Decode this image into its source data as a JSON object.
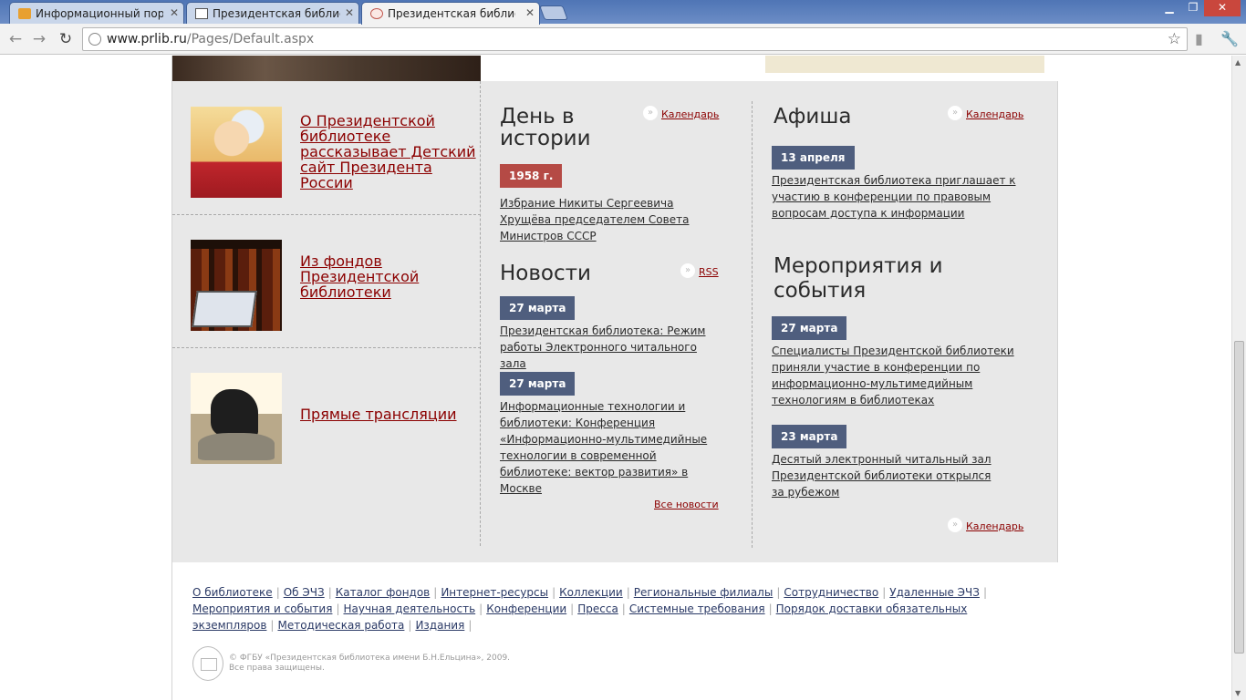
{
  "browser": {
    "tabs": [
      {
        "label": "Информационный портал",
        "active": false
      },
      {
        "label": "Президентская библиотека",
        "active": false
      },
      {
        "label": "Президентская библиотека",
        "active": true
      }
    ],
    "url_host": "www.prlib.ru",
    "url_path": "/Pages/Default.aspx"
  },
  "left": {
    "promos": [
      {
        "label": "О Президентской библиотеке рассказывает Детский сайт Президента России",
        "icon": "cartoon-boy-image"
      },
      {
        "label": "Из фондов Президентской библиотеки",
        "icon": "books-laptop-image"
      },
      {
        "label": "Прямые трансляции",
        "icon": "statue-image"
      }
    ]
  },
  "history": {
    "title": "День в истории",
    "calendar_label": "Календарь",
    "date": "1958 г.",
    "text": "Избрание Никиты Сергеевича Хрущёва председателем Совета Министров СССР"
  },
  "news": {
    "title": "Новости",
    "rss_label": "RSS",
    "items": [
      {
        "date": "27 марта",
        "text": "Президентская библиотека: Режим работы Электронного читального зала"
      },
      {
        "date": "27 марта",
        "text": "Информационные технологии и библиотеки: Конференция «Информационно-мультимедийные технологии в современной библиотеке: вектор развития» в Москве"
      }
    ],
    "all_label": "Все новости"
  },
  "afisha": {
    "title": "Афиша",
    "calendar_label": "Календарь",
    "date": "13 апреля",
    "text": "Президентская библиотека приглашает к участию в конференции по правовым вопросам доступа к информации"
  },
  "events": {
    "title": "Мероприятия и события",
    "items": [
      {
        "date": "27 марта",
        "text": "Специалисты Президентской библиотеки приняли участие в конференции по информационно-мультимедийным технологиям в библиотеках"
      },
      {
        "date": "23 марта",
        "text": "Десятый электронный читальный зал Президентской библиотеки открылся за рубежом"
      }
    ],
    "calendar_label": "Календарь"
  },
  "footer": {
    "links": [
      "О библиотеке",
      "Об ЭЧЗ",
      "Каталог фондов",
      "Интернет-ресурсы",
      "Коллекции",
      "Региональные филиалы",
      "Сотрудничество",
      "Удаленные ЭЧЗ",
      "Мероприятия и события",
      "Научная деятельность",
      "Конференции",
      "Пресса",
      "Системные требования",
      "Порядок доставки обязательных экземпляров",
      "Методическая работа",
      "Издания"
    ],
    "copyright_line1": "© ФГБУ «Президентская библиотека имени Б.Н.Ельцина», 2009.",
    "copyright_line2": "Все права защищены."
  },
  "colors": {
    "accent_red": "#8b0000",
    "badge_red": "#b54a45",
    "badge_blue": "#4f5e7e",
    "tabbar": "#5a7eb9"
  }
}
